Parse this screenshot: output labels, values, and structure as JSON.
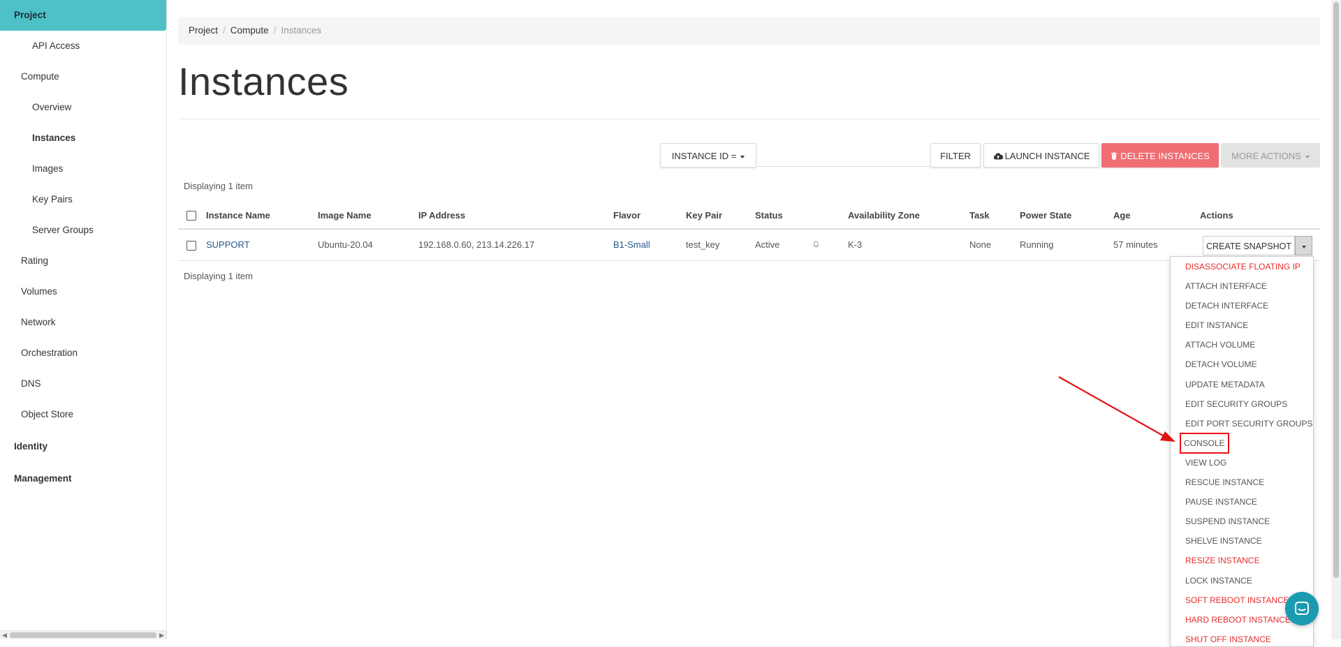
{
  "sidebar": {
    "items": [
      {
        "label": "Project",
        "level": 0
      },
      {
        "label": "API Access",
        "level": 2
      },
      {
        "label": "Compute",
        "level": 1
      },
      {
        "label": "Overview",
        "level": 2
      },
      {
        "label": "Instances",
        "level": 2
      },
      {
        "label": "Images",
        "level": 2
      },
      {
        "label": "Key Pairs",
        "level": 2
      },
      {
        "label": "Server Groups",
        "level": 2
      },
      {
        "label": "Rating",
        "level": 1
      },
      {
        "label": "Volumes",
        "level": 1
      },
      {
        "label": "Network",
        "level": 1
      },
      {
        "label": "Orchestration",
        "level": 1
      },
      {
        "label": "DNS",
        "level": 1
      },
      {
        "label": "Object Store",
        "level": 1
      },
      {
        "label": "Identity",
        "level": 0
      },
      {
        "label": "Management",
        "level": 0
      }
    ]
  },
  "breadcrumb": {
    "c1": "Project",
    "c2": "Compute",
    "c3": "Instances"
  },
  "page": {
    "title": "Instances"
  },
  "toolbar": {
    "filter_field": "INSTANCE ID =",
    "filter_value": "",
    "filter_btn": "FILTER",
    "launch_btn": "LAUNCH INSTANCE",
    "delete_btn": "DELETE INSTANCES",
    "more_btn": "MORE ACTIONS"
  },
  "table": {
    "count_text": "Displaying 1 item",
    "headers": {
      "name": "Instance Name",
      "image": "Image Name",
      "ip": "IP Address",
      "flavor": "Flavor",
      "keypair": "Key Pair",
      "status": "Status",
      "az": "Availability Zone",
      "task": "Task",
      "power": "Power State",
      "age": "Age",
      "actions": "Actions"
    },
    "row": {
      "name": "SUPPORT",
      "image": "Ubuntu-20.04",
      "ip": "192.168.0.60, 213.14.226.17",
      "flavor": "B1-Small",
      "keypair": "test_key",
      "status": "Active",
      "az": "K-3",
      "task": "None",
      "power": "Running",
      "age": "57 minutes",
      "action_btn": "CREATE SNAPSHOT"
    }
  },
  "actions_menu": [
    {
      "label": "DISASSOCIATE FLOATING IP",
      "danger": true
    },
    {
      "label": "ATTACH INTERFACE"
    },
    {
      "label": "DETACH INTERFACE"
    },
    {
      "label": "EDIT INSTANCE"
    },
    {
      "label": "ATTACH VOLUME"
    },
    {
      "label": "DETACH VOLUME"
    },
    {
      "label": "UPDATE METADATA"
    },
    {
      "label": "EDIT SECURITY GROUPS"
    },
    {
      "label": "EDIT PORT SECURITY GROUPS"
    },
    {
      "label": "CONSOLE",
      "highlight": true
    },
    {
      "label": "VIEW LOG"
    },
    {
      "label": "RESCUE INSTANCE"
    },
    {
      "label": "PAUSE INSTANCE"
    },
    {
      "label": "SUSPEND INSTANCE"
    },
    {
      "label": "SHELVE INSTANCE"
    },
    {
      "label": "RESIZE INSTANCE",
      "danger": true
    },
    {
      "label": "LOCK INSTANCE"
    },
    {
      "label": "SOFT REBOOT INSTANCE",
      "danger": true
    },
    {
      "label": "HARD REBOOT INSTANCE",
      "danger": true
    },
    {
      "label": "SHUT OFF INSTANCE",
      "danger": true
    }
  ],
  "colors": {
    "accent": "#4dc1c6",
    "danger": "#f06d72",
    "link": "#2a5a8a",
    "annotation": "#e11111"
  }
}
